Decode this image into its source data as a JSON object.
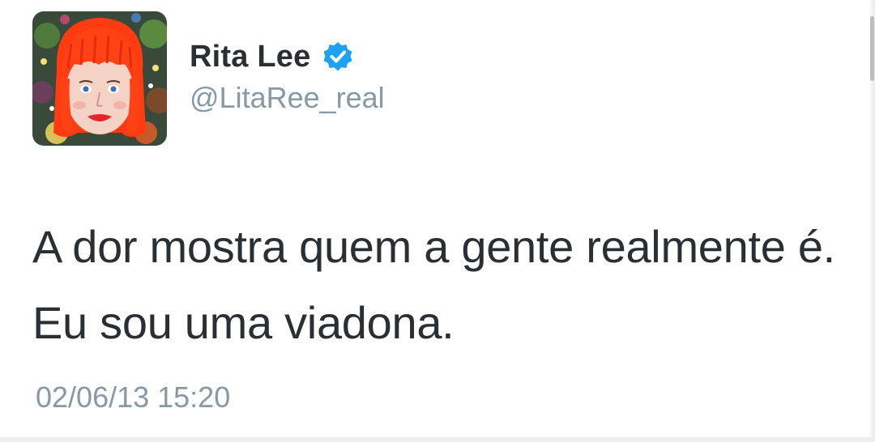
{
  "tweet": {
    "author": {
      "display_name": "Rita Lee",
      "handle": "@LitaRee_real",
      "verified_icon": "verified-badge-icon",
      "avatar": "avatar-red-hair-illustration"
    },
    "text": "A dor mostra quem a gente realmente é. Eu sou uma viadona.",
    "timestamp": "02/06/13 15:20"
  },
  "colors": {
    "name_text": "#292f33",
    "secondary_text": "#8899a6",
    "verified_blue": "#1da1f2",
    "background": "#ffffff"
  }
}
